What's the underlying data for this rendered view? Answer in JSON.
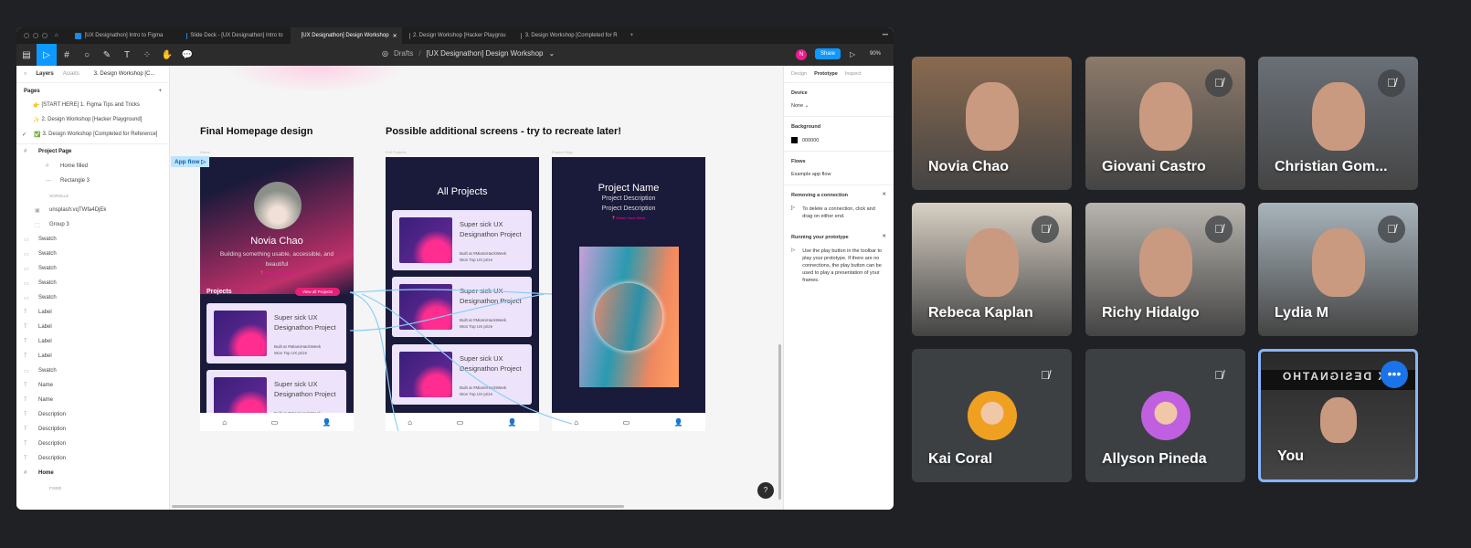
{
  "figma": {
    "tabs": [
      {
        "label": "[UX Designathon] Intro to Figma",
        "active": false
      },
      {
        "label": "Slide Deck - [UX Designathon] Intro to",
        "active": false
      },
      {
        "label": "[UX Designathon] Design Workshop",
        "active": true
      },
      {
        "label": "2. Design Workshop [Hacker Playgrou",
        "active": false
      },
      {
        "label": "3. Design Workshop [Completed for R",
        "active": false
      }
    ],
    "toolbar": {
      "drafts": "Drafts",
      "separator": "/",
      "file_title": "[UX Designathon] Design Workshop",
      "avatar_initial": "N",
      "share": "Share",
      "zoom": "90%"
    },
    "left": {
      "tab_layers": "Layers",
      "tab_assets": "Assets",
      "page_selector": "3. Design Workshop [C...",
      "pages_title": "Pages",
      "pages": [
        "[START HERE] 1. Figma Tips and Tricks",
        "2. Design Workshop [Hacker Playground]",
        "3. Design Workshop [Completed for Reference]"
      ],
      "layers": [
        {
          "icon": "frame",
          "label": "Project Page",
          "bold": true
        },
        {
          "icon": "frame",
          "label": "Home filled",
          "indent": 2
        },
        {
          "icon": "line",
          "label": "Rectangle 3",
          "indent": 2
        },
        {
          "icon": "section",
          "label": "SCROLLS",
          "indent": 1
        },
        {
          "icon": "image",
          "label": "unsplash:vqTWfa4DjEk",
          "indent": 1
        },
        {
          "icon": "group",
          "label": "Group 3",
          "indent": 1
        },
        {
          "icon": "rect",
          "label": "Swatch"
        },
        {
          "icon": "rect",
          "label": "Swatch"
        },
        {
          "icon": "rect",
          "label": "Swatch"
        },
        {
          "icon": "rect",
          "label": "Swatch"
        },
        {
          "icon": "rect",
          "label": "Swatch"
        },
        {
          "icon": "text",
          "label": "Label"
        },
        {
          "icon": "text",
          "label": "Label"
        },
        {
          "icon": "text",
          "label": "Label"
        },
        {
          "icon": "text",
          "label": "Label"
        },
        {
          "icon": "rect",
          "label": "Swatch"
        },
        {
          "icon": "text",
          "label": "Name"
        },
        {
          "icon": "text",
          "label": "Name"
        },
        {
          "icon": "text",
          "label": "Description"
        },
        {
          "icon": "text",
          "label": "Description"
        },
        {
          "icon": "text",
          "label": "Description"
        },
        {
          "icon": "text",
          "label": "Description"
        },
        {
          "icon": "frame",
          "label": "Home",
          "bold": true
        },
        {
          "icon": "section",
          "label": "FIXED",
          "indent": 1
        }
      ]
    },
    "right": {
      "tabs": [
        "Design",
        "Prototype",
        "Inspect"
      ],
      "device_title": "Device",
      "device_value": "None",
      "bg_title": "Background",
      "bg_value": "000000",
      "flows_title": "Flows",
      "flow_name": "Example app flow",
      "remove_title": "Removing a connection",
      "remove_text": "To delete a connection, click and drag on either end.",
      "run_title": "Running your prototype",
      "run_text": "Use the play button in the toolbar to play your prototype. If there are no connections, the play button can be used to play a presentation of your frames."
    },
    "canvas": {
      "heading1": "Final Homepage design",
      "heading2": "Possible additional screens - try to recreate later!",
      "flow_tag": "App flow",
      "frame_labels": [
        "Home",
        "Edit Projects",
        "Project Page"
      ],
      "home": {
        "name": "Novia Chao",
        "bio": "Building something usable, accessible, and beautiful",
        "location": "Miami Hack Week",
        "projects": "Projects",
        "view_all": "View all Projects"
      },
      "all_projects_title": "All Projects",
      "card": {
        "title": "Super sick UX Designathon Project",
        "line1": "Built at #MiamiHackWeek",
        "line2": "Won Top UX prize"
      },
      "project_page": {
        "name": "Project Name",
        "desc1": "Project Description",
        "desc2": "Project Description",
        "location": "Miami Hack Week"
      },
      "help": "?"
    }
  },
  "meet": {
    "tiles": [
      {
        "name": "Novia Chao",
        "muted": false,
        "bg": "#8a6a50"
      },
      {
        "name": "Giovani Castro",
        "muted": true,
        "bg": "#8c7a6a"
      },
      {
        "name": "Christian Gom...",
        "muted": true,
        "bg": "#6a7078"
      },
      {
        "name": "Rebeca Kaplan",
        "muted": true,
        "bg": "#d8d0c4"
      },
      {
        "name": "Richy Hidalgo",
        "muted": true,
        "bg": "#b8b4ae"
      },
      {
        "name": "Lydia M",
        "muted": true,
        "bg": "#a8b4bc"
      },
      {
        "name": "Kai Coral",
        "muted": true,
        "avatar": true,
        "bg": "#3c4043"
      },
      {
        "name": "Allyson Pineda",
        "muted": true,
        "avatar": true,
        "bg": "#3c4043"
      },
      {
        "name": "You",
        "muted": false,
        "self": true,
        "bg": "#2a2a2a",
        "sign": "UX DESIGNATHO"
      }
    ],
    "accent": "#8ab4f8"
  }
}
